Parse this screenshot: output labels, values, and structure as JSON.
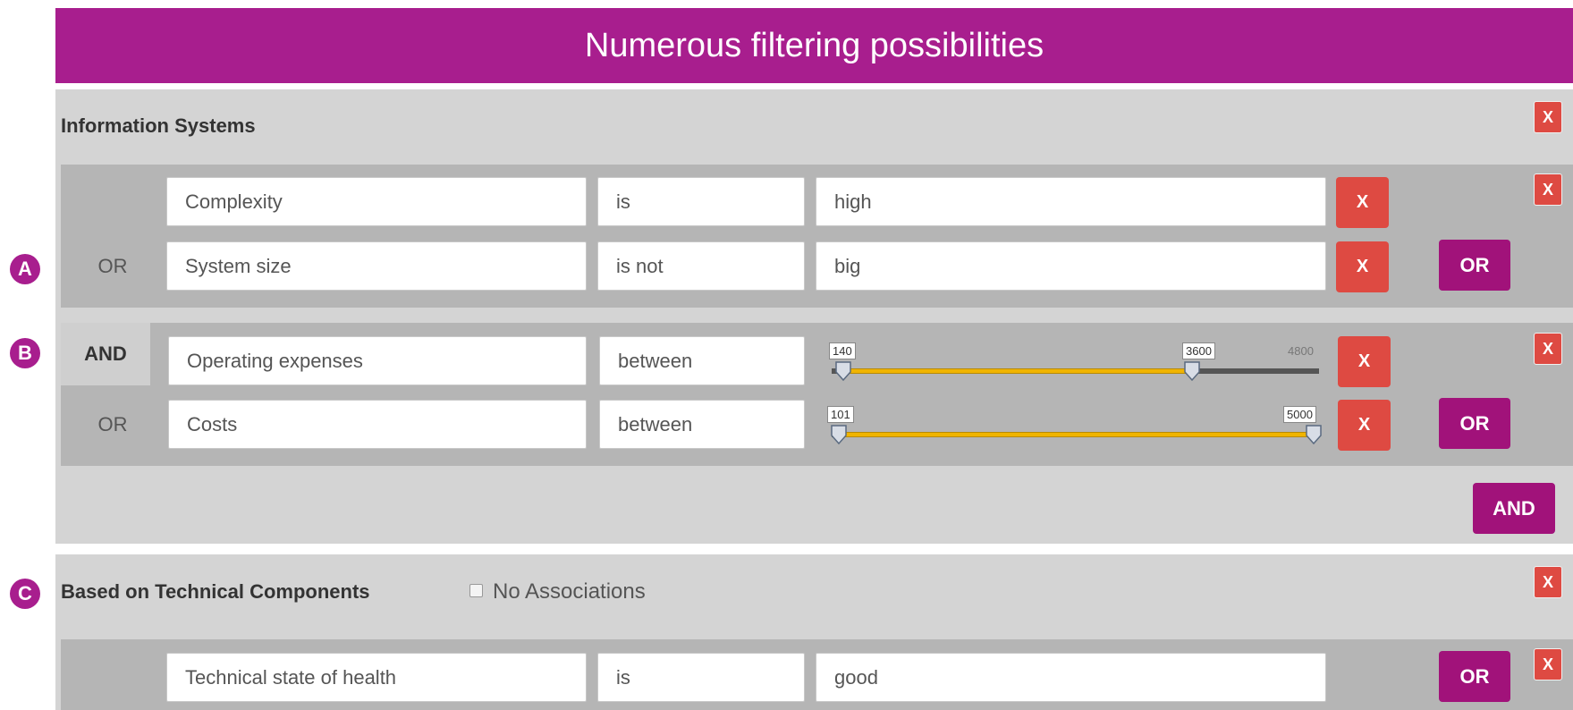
{
  "banner": {
    "title": "Numerous filtering possibilities"
  },
  "markers": {
    "a": "A",
    "b": "B",
    "c": "C"
  },
  "colors": {
    "accent": "#a81e8e",
    "button_purple": "#a1127a",
    "remove_red": "#de4a42",
    "slider_fill": "#f0b400"
  },
  "section1": {
    "title": "Information Systems",
    "remove": "X",
    "group1": {
      "remove": "X",
      "rows": [
        {
          "connector": "",
          "attribute": "Complexity",
          "operator": "is",
          "value": "high",
          "remove": "X"
        },
        {
          "connector": "OR",
          "attribute": "System size",
          "operator": "is not",
          "value": "big",
          "remove": "X"
        }
      ],
      "or_button": "OR"
    },
    "group2": {
      "remove": "X",
      "connector": "AND",
      "rows": [
        {
          "connector": "",
          "attribute": "Operating expenses",
          "operator": "between",
          "slider": {
            "min_label": "140",
            "max_label": "3600",
            "range_max": "4800",
            "low": 140,
            "high": 3600,
            "scale_max": 4800
          },
          "remove": "X"
        },
        {
          "connector": "OR",
          "attribute": "Costs",
          "operator": "between",
          "slider": {
            "min_label": "101",
            "max_label": "5000",
            "low": 101,
            "high": 5000,
            "scale_max": 5000
          },
          "remove": "X"
        }
      ],
      "or_button": "OR"
    },
    "and_button": "AND"
  },
  "section2": {
    "title": "Based on Technical Components",
    "checkbox_label": "No Associations",
    "checkbox_checked": false,
    "remove": "X",
    "group1": {
      "remove": "X",
      "rows": [
        {
          "connector": "",
          "attribute": "Technical state of health",
          "operator": "is",
          "value": "good"
        }
      ],
      "or_button": "OR"
    }
  }
}
